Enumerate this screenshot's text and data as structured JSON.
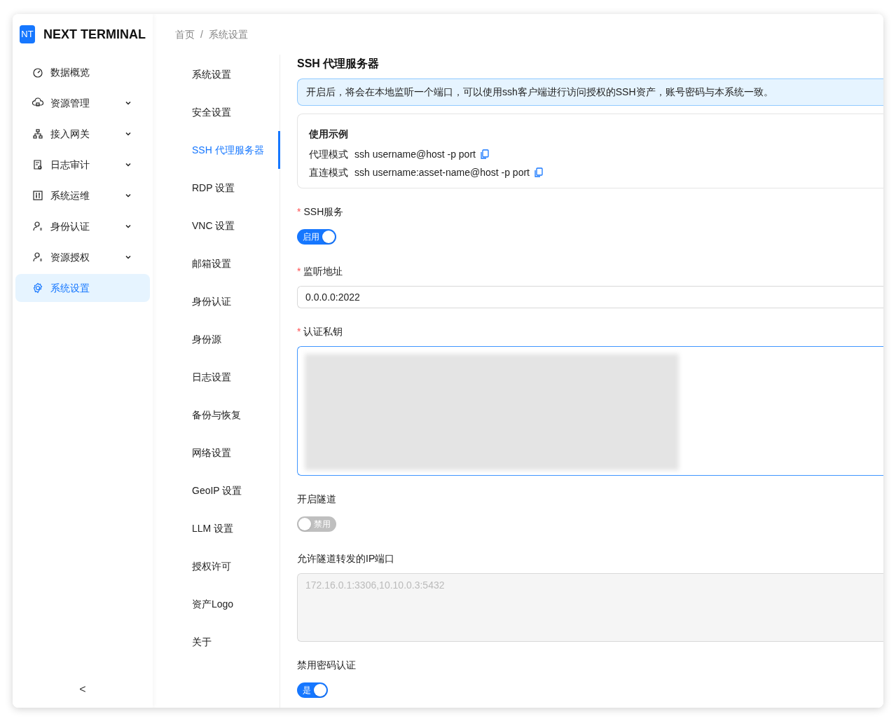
{
  "app": {
    "logo": "NT",
    "name": "NEXT TERMINAL"
  },
  "nav": [
    {
      "label": "数据概览",
      "expandable": false,
      "selected": false
    },
    {
      "label": "资源管理",
      "expandable": true,
      "selected": false
    },
    {
      "label": "接入网关",
      "expandable": true,
      "selected": false
    },
    {
      "label": "日志审计",
      "expandable": true,
      "selected": false
    },
    {
      "label": "系统运维",
      "expandable": true,
      "selected": false
    },
    {
      "label": "身份认证",
      "expandable": true,
      "selected": false
    },
    {
      "label": "资源授权",
      "expandable": true,
      "selected": false
    },
    {
      "label": "系统设置",
      "expandable": false,
      "selected": true
    }
  ],
  "collapse": "<",
  "breadcrumb": [
    "首页",
    "系统设置"
  ],
  "breadcrumb_separator": "/",
  "settings_menu": [
    {
      "label": "系统设置",
      "selected": false
    },
    {
      "label": "安全设置",
      "selected": false
    },
    {
      "label": "SSH 代理服务器",
      "selected": true
    },
    {
      "label": "RDP 设置",
      "selected": false
    },
    {
      "label": "VNC 设置",
      "selected": false
    },
    {
      "label": "邮箱设置",
      "selected": false
    },
    {
      "label": "身份认证",
      "selected": false
    },
    {
      "label": "身份源",
      "selected": false
    },
    {
      "label": "日志设置",
      "selected": false
    },
    {
      "label": "备份与恢复",
      "selected": false
    },
    {
      "label": "网络设置",
      "selected": false
    },
    {
      "label": "GeoIP 设置",
      "selected": false
    },
    {
      "label": "LLM 设置",
      "selected": false
    },
    {
      "label": "授权许可",
      "selected": false
    },
    {
      "label": "资产Logo",
      "selected": false
    },
    {
      "label": "关于",
      "selected": false
    }
  ],
  "section_title": "SSH 代理服务器",
  "info": "开启后，将会在本地监听一个端口，可以使用ssh客户端进行访问授权的SSH资产，账号密码与本系统一致。",
  "example": {
    "title": "使用示例",
    "rows": [
      {
        "label": "代理模式",
        "command": "ssh username@host -p port"
      },
      {
        "label": "直连模式",
        "command": "ssh username:asset-name@host -p port"
      }
    ]
  },
  "fields": [
    {
      "kind": "switch",
      "label": "SSH服务",
      "required_mark": "*",
      "on": true,
      "text": "启用"
    },
    {
      "kind": "input",
      "label": "监听地址",
      "required_mark": "*",
      "value": "0.0.0.0:2022"
    },
    {
      "kind": "hidden_textarea",
      "label": "认证私钥",
      "required_mark": "*",
      "focused": true
    },
    {
      "kind": "switch",
      "label": "开启隧道",
      "on": false,
      "text": "禁用"
    },
    {
      "kind": "textarea",
      "label": "允许隧道转发的IP端口",
      "disabled": true,
      "placeholder": "172.16.0.1:3306,10.10.0.3:5432"
    },
    {
      "kind": "switch",
      "label": "禁用密码认证",
      "on": true,
      "text": "是"
    }
  ]
}
